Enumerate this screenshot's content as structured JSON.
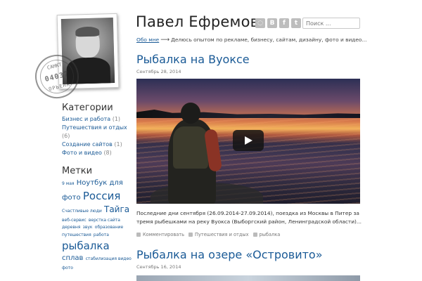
{
  "site": {
    "title": "Павел Ефремов",
    "about_link": "Обо мне",
    "tagline": "Делюсь опытом по рекламе, бизнесу, сайтам, дизайну, фото и видео...",
    "search_placeholder": "Поиск ...",
    "social": [
      "rss-icon",
      "vk-icon",
      "facebook-icon",
      "twitter-icon"
    ],
    "social_glyphs": [
      "◌",
      "B",
      "f",
      "t"
    ]
  },
  "stamp": {
    "line1": "САНКТ",
    "line2": "04037",
    "line3": "ОРЬЕНК"
  },
  "sidebar": {
    "categories_title": "Категории",
    "categories": [
      {
        "label": "Бизнес и работа",
        "count": "(1)"
      },
      {
        "label": "Путешествия и отдых",
        "count": "(6)"
      },
      {
        "label": "Создание сайтов",
        "count": "(1)"
      },
      {
        "label": "Фото и видео",
        "count": "(8)"
      }
    ],
    "tags_title": "Метки",
    "tags": [
      {
        "label": "9 мая",
        "size": "xs"
      },
      {
        "label": "Ноутбук для фото",
        "size": "m"
      },
      {
        "label": "Россия",
        "size": "xl"
      },
      {
        "label": "Счастливые люди",
        "size": "xs"
      },
      {
        "label": "Тайга",
        "size": "l"
      },
      {
        "label": "веб-сервис",
        "size": "xs"
      },
      {
        "label": "верстка сайта",
        "size": "xs"
      },
      {
        "label": "деревня",
        "size": "xs"
      },
      {
        "label": "звук",
        "size": "xs"
      },
      {
        "label": "образование",
        "size": "xs"
      },
      {
        "label": "путешествия",
        "size": "xs"
      },
      {
        "label": "работа",
        "size": "xs"
      },
      {
        "label": "рыбалка",
        "size": "xl"
      },
      {
        "label": "сплав",
        "size": "m"
      },
      {
        "label": "стабилизация видео",
        "size": "xs"
      },
      {
        "label": "фото",
        "size": "xs"
      }
    ]
  },
  "posts": [
    {
      "title": "Рыбалка на Вуоксе",
      "date": "Сентябрь 28, 2014",
      "excerpt": "Последние дни сентября (26.09.2014-27.09.2014), поездка из Москвы в Питер за тремя рыбешками на реку Вуокса (Выборгский район, Ленинградской области)...",
      "comments": "Комментировать",
      "category": "Путешествия и отдых",
      "tag": "рыбалка"
    },
    {
      "title": "Рыбалка на озере «Островито»",
      "date": "Сентябрь 16, 2014"
    }
  ]
}
